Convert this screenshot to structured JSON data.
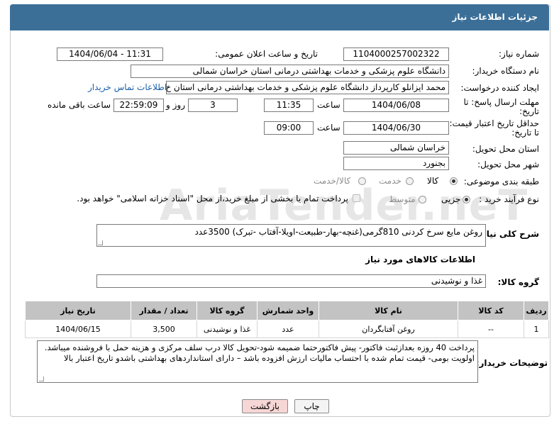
{
  "header": {
    "title": "جزئیات اطلاعات نیاز"
  },
  "watermark": "AriaTender.neT",
  "form": {
    "need_number_label": "شماره نیاز:",
    "need_number": "1104000257002322",
    "announce_label": "تاریخ و ساعت اعلان عمومی:",
    "announce_value": "1404/06/04 - 11:31",
    "buyer_label": "نام دستگاه خریدار:",
    "buyer_value": "دانشگاه علوم پزشکی و خدمات بهداشتی درمانی استان خراسان شمالی",
    "creator_label": "ایجاد کننده درخواست:",
    "creator_value": "محمد ایزانلو کارپرداز دانشگاه علوم پزشکی و خدمات بهداشتی درمانی استان خ",
    "contact_link": "اطلاعات تماس خریدار",
    "deadline_label": "مهلت ارسال پاسخ: تا",
    "deadline_label2": "تاریخ:",
    "deadline_date": "1404/06/08",
    "time_label": "ساعت",
    "deadline_time": "11:35",
    "days_value": "3",
    "days_label": "روز و",
    "remain_time": "22:59:09",
    "remain_label": "ساعت باقی مانده",
    "validity_label": "حداقل تاریخ اعتبار قیمت:",
    "validity_label2": "تا تاریخ:",
    "validity_date": "1404/06/30",
    "validity_time_label": "ساعت",
    "validity_time": "09:00",
    "province_label": "استان محل تحویل:",
    "province_value": "خراسان شمالی",
    "city_label": "شهر محل تحویل:",
    "city_value": "بجنورد",
    "category_label": "طبقه بندی موضوعی:",
    "category_options": [
      "کالا",
      "خدمت",
      "کالا/خدمت"
    ],
    "process_label": "نوع فرآیند خرید :",
    "process_options": [
      "جزیی",
      "متوسط"
    ],
    "payment_note": "پرداخت تمام یا بخشی از مبلغ خرید،از محل \"اسناد خزانه اسلامی\" خواهد بود.",
    "description_label": "شرح کلی نیاز:",
    "description_value": "روغن مایع سرخ کردنی 810گرمی(غنچه-بهار-طبیعت-اویلا-آفتاب -تبرک) 3500عدد",
    "goods_info_title": "اطلاعات کالاهای مورد نیاز",
    "goods_group_label": "گروه کالا:",
    "goods_group_value": "غذا و نوشیدنی",
    "buyer_notes_label": "توضیحات خریدار:",
    "buyer_notes_value": "پرداخت 40 روزه بعدازثبت فاکتور- پیش فاکتورحتما ضمیمه شود-تحویل کالا درب سلف مرکزی و هزینه حمل با فروشنده میباشد. اولویت بومی-  قیمت  تمام شده با احتساب مالیات ارزش افزوده باشد – دارای استانداردهای بهداشتی باشدو تاریخ اعتبار بالا"
  },
  "table": {
    "headers": [
      "ردیف",
      "کد کالا",
      "نام کالا",
      "واحد شمارش",
      "گروه کالا",
      "تعداد / مقدار",
      "تاریخ نیاز"
    ],
    "rows": [
      [
        "1",
        "--",
        "روغن آفتابگردان",
        "عدد",
        "غذا و نوشیدنی",
        "3,500",
        "1404/06/15"
      ]
    ]
  },
  "buttons": {
    "print": "چاپ",
    "back": "بازگشت"
  },
  "colors": {
    "header_bg": "#3b6f98",
    "link": "#1b5fa8",
    "table_head": "#c3c3c3",
    "back_btn": "#f7d6d6"
  }
}
